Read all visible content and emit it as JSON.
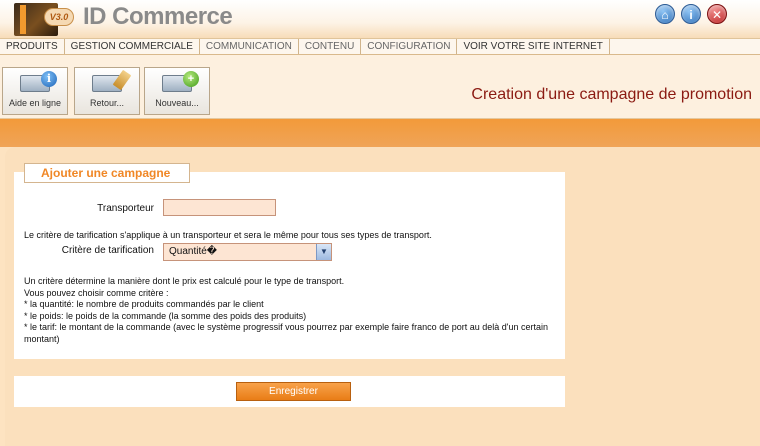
{
  "header": {
    "logo_badge": "V3.0",
    "app_title": "ID Commerce",
    "icons": [
      "home-icon",
      "info-icon",
      "close-icon"
    ]
  },
  "nav": {
    "items": [
      "PRODUITS",
      "GESTION COMMERCIALE",
      "COMMUNICATION",
      "CONTENU",
      "CONFIGURATION",
      "VOIR VOTRE SITE INTERNET"
    ]
  },
  "toolbar": {
    "help_label": "Aide en ligne",
    "back_label": "Retour...",
    "new_label": "Nouveau..."
  },
  "page_title": "Creation d'une campagne de promotion",
  "form": {
    "legend": "Ajouter une campagne",
    "transporteur_label": "Transporteur",
    "transporteur_value": "",
    "critere_note": "Le critère de tarification s'applique à un transporteur et sera le même pour tous ses types de transport.",
    "critere_label": "Critère de tarification",
    "critere_value": "Quantité�",
    "help_lines": [
      "Un critère détermine la manière dont le prix est calculé pour le type de transport.",
      "Vous pouvez choisir comme critère :",
      "* la quantité: le nombre de produits commandés par le client",
      "* le poids: le poids de la commande (la somme des poids des produits)",
      "* le tarif: le montant de la commande (avec le système progressif vous pourrez par exemple faire franco de port au delà d'un certain montant)"
    ],
    "submit_label": "Enregistrer"
  },
  "colors": {
    "accent": "#f08726",
    "title": "#8b1a12",
    "input_bg": "#fde5d3"
  }
}
